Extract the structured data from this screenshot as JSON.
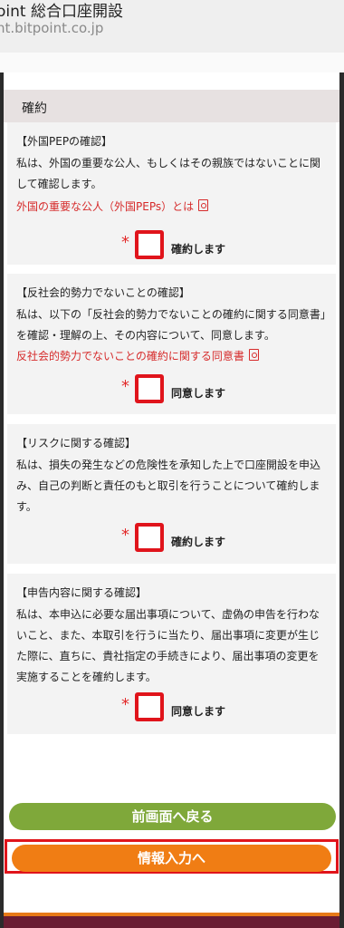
{
  "browser": {
    "title": "oint 総合口座開設",
    "url": "nt.bitpoint.co.jp"
  },
  "section": {
    "title": "確約"
  },
  "items": [
    {
      "heading": "【外国PEPの確認】",
      "body": "私は、外国の重要な公人、もしくはその親族ではないことに関して確認します。",
      "link": "外国の重要な公人（外国PEPs）とは",
      "required_mark": "*",
      "check_label": "確約します"
    },
    {
      "heading": "【反社会的勢力でないことの確認】",
      "body": "私は、以下の「反社会的勢力でないことの確約に関する同意書」を確認・理解の上、その内容について、同意します。",
      "link": "反社会的勢力でないことの確約に関する同意書",
      "required_mark": "*",
      "check_label": "同意します"
    },
    {
      "heading": "【リスクに関する確認】",
      "body": "私は、損失の発生などの危険性を承知した上で口座開設を申込み、自己の判断と責任のもと取引を行うことについて確約します。",
      "required_mark": "*",
      "check_label": "確約します"
    },
    {
      "heading": "【申告内容に関する確認】",
      "body": "私は、本申込に必要な届出事項について、虚偽の申告を行わないこと、また、本取引を行うに当たり、届出事項に変更が生じた際に、直ちに、貴社指定の手続きにより、届出事項の変更を実施することを確約します。",
      "required_mark": "*",
      "check_label": "同意します"
    }
  ],
  "buttons": {
    "back_label": "前画面へ戻る",
    "next_label": "情報入力へ"
  },
  "colors": {
    "back_button": "#7fa83a",
    "next_button": "#f07d14",
    "required": "#e22a2a",
    "link": "#d62b2b",
    "highlight_border": "#e0141b"
  },
  "icons": {
    "pdf": "pdf-icon"
  }
}
